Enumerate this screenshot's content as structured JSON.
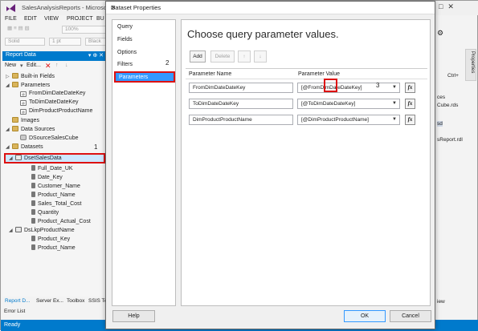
{
  "app": {
    "title": "SalesAnalysisReports - Microsoft V",
    "menu": [
      "FILE",
      "EDIT",
      "VIEW",
      "PROJECT",
      "BU"
    ],
    "toolbar": {
      "zoom": "100%",
      "line_style": "Solid",
      "line_width": "1 pt",
      "line_color": "Black"
    }
  },
  "report_data": {
    "title": "Report Data",
    "new_label": "New",
    "edit_label": "Edit...",
    "tree": {
      "builtin_fields": "Built-in Fields",
      "parameters": "Parameters",
      "param_items": [
        "FromDimDateDateKey",
        "ToDimDateDateKey",
        "DimProductProductName"
      ],
      "images": "Images",
      "data_sources": "Data Sources",
      "data_source_item": "DSourceSalesCube",
      "datasets": "Datasets",
      "dataset1": "DsetSalesData",
      "dataset1_fields": [
        "Full_Date_UK",
        "Date_Key",
        "Customer_Name",
        "Product_Name",
        "Sales_Total_Cost",
        "Quantity",
        "Product_Actual_Cost"
      ],
      "dataset2": "DsLkpProductName",
      "dataset2_fields": [
        "Product_Key",
        "Product_Name"
      ]
    }
  },
  "bottom_tabs": [
    "Report D...",
    "Server Ex...",
    "Toolbox",
    "SSIS Too"
  ],
  "error_list": "Error List",
  "status": "Ready",
  "right_panel": {
    "items": [
      "ces",
      "Cube.rds",
      "sd",
      "sReport.rdl",
      "iew"
    ],
    "properties_tab": "Properties",
    "search_hint": "Ctrl+"
  },
  "dialog": {
    "title": "Dataset Properties",
    "nav_items": [
      "Query",
      "Fields",
      "Options",
      "Filters",
      "Parameters"
    ],
    "selected_nav": "Parameters",
    "heading": "Choose query parameter values.",
    "buttons": {
      "add": "Add",
      "delete": "Delete",
      "up": "↑",
      "down": "↓"
    },
    "columns": {
      "name": "Parameter Name",
      "value": "Parameter Value"
    },
    "rows": [
      {
        "name": "FromDimDateDateKey",
        "value": "[@FromDimDateDateKey]"
      },
      {
        "name": "ToDimDateDateKey",
        "value": "[@ToDimDateDateKey]"
      },
      {
        "name": "DimProductProductName",
        "value": "[@DimProductProductName]"
      }
    ],
    "fx_label": "fx",
    "help": "Help",
    "ok": "OK",
    "cancel": "Cancel"
  },
  "callouts": {
    "one": "1",
    "two": "2",
    "three": "3"
  },
  "colors": {
    "accent": "#007acc",
    "highlight": "#dd1111",
    "selection": "#3399ff"
  }
}
